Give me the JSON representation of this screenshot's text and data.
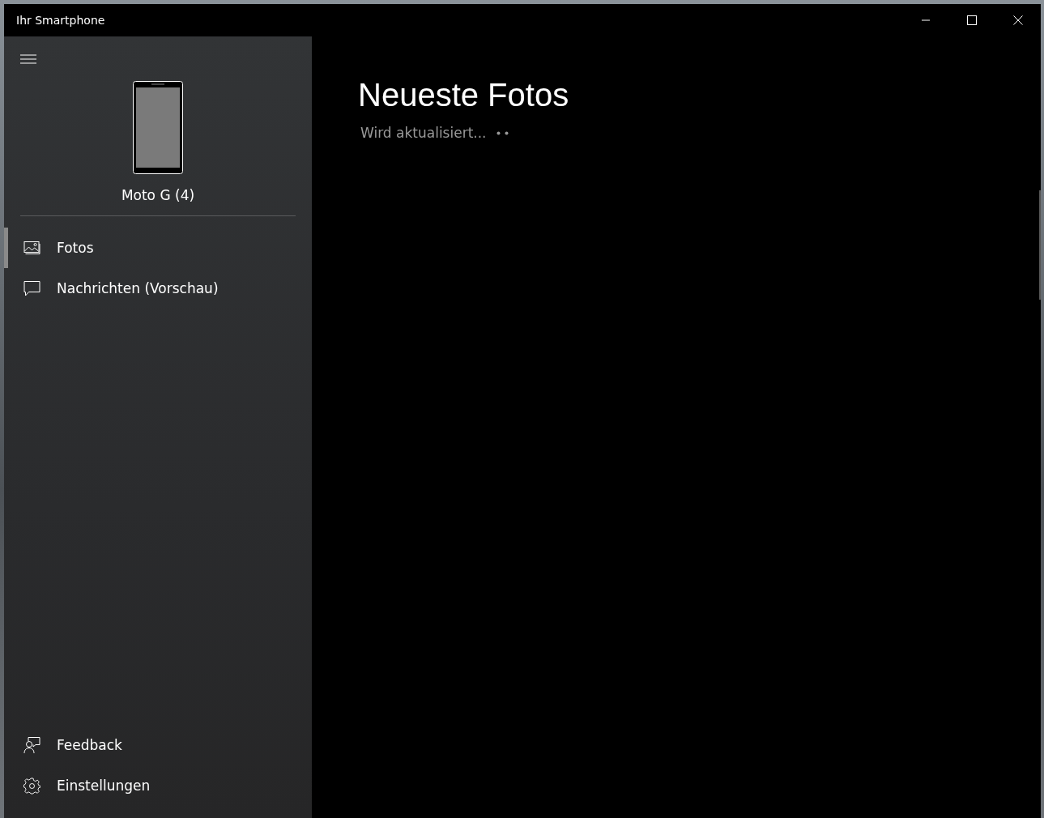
{
  "window": {
    "title": "Ihr Smartphone"
  },
  "sidebar": {
    "device_name": "Moto G (4)",
    "items": [
      {
        "label": "Fotos",
        "kind": "photos",
        "selected": true
      },
      {
        "label": "Nachrichten (Vorschau)",
        "kind": "messages",
        "selected": false
      }
    ],
    "footer_items": [
      {
        "label": "Feedback",
        "kind": "feedback"
      },
      {
        "label": "Einstellungen",
        "kind": "settings"
      }
    ]
  },
  "main": {
    "heading": "Neueste Fotos",
    "status": "Wird aktualisiert..."
  }
}
